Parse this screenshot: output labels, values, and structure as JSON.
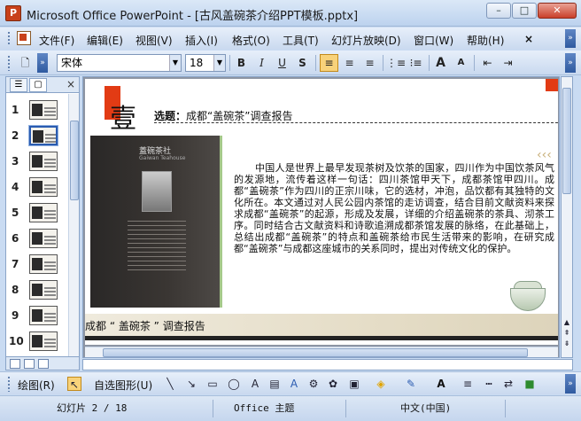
{
  "window": {
    "title": "Microsoft Office PowerPoint - [古风盖碗茶介绍PPT模板.pptx]",
    "app_icon_label": "P",
    "minimize": "–",
    "maximize": "□",
    "close": "✕"
  },
  "menu": {
    "items": [
      "文件(F)",
      "编辑(E)",
      "视图(V)",
      "插入(I)",
      "格式(O)",
      "工具(T)",
      "幻灯片放映(D)",
      "窗口(W)",
      "帮助(H)"
    ],
    "close_doc": "×"
  },
  "toolbar": {
    "new_icon": "new-doc-icon",
    "font_name": "宋体",
    "font_size": "18",
    "bold": "B",
    "italic": "I",
    "underline": "U",
    "shadow": "S",
    "align_left": "≡",
    "align_center": "≡",
    "align_right": "≡",
    "numbering": "⋮≡",
    "bullets": "⁝≡",
    "grow_font": "A",
    "shrink_font": "A",
    "decrease_indent": "⇤",
    "increase_indent": "⇥"
  },
  "outline_pane": {
    "close": "×",
    "slides": [
      {
        "number": "1"
      },
      {
        "number": "2",
        "selected": true
      },
      {
        "number": "3"
      },
      {
        "number": "4"
      },
      {
        "number": "5"
      },
      {
        "number": "6"
      },
      {
        "number": "7"
      },
      {
        "number": "8"
      },
      {
        "number": "9"
      },
      {
        "number": "10"
      }
    ]
  },
  "slide": {
    "big_char": "壹",
    "topic_label": "选题：",
    "topic_text": "成都“盖碗茶”调查报告",
    "photo_sign": "蓋碗茶社",
    "photo_sign_sub": "Gaiwan Teahouse",
    "body": "中国人是世界上最早发现茶树及饮茶的国家，四川作为中国饮茶风气的发源地，流传着这样一句话：四川茶馆甲天下，成都茶馆甲四川。成都“盖碗茶”作为四川的正宗川味，它的选材，冲泡，品饮都有其独特的文化所在。本文通过对人民公园内茶馆的走访调查，结合目前文献资料来探求成都“盖碗茶”的起源，形成及发展，详细的介绍盖碗茶的茶具、沏茶工序。同时结合古文献资料和诗歌追溯成都茶馆发展的脉络，在此基础上，总结出成都“盖碗茶”的特点和盖碗茶给市民生活带来的影响，在研究成都“盖碗茶”与成都这座城市的关系同时，提出对传统文化的保护。",
    "quote_mark": "‹‹‹",
    "footer": "成都 “ 盖碗茶 ” 调查报告"
  },
  "drawing_toolbar": {
    "draw_label": "绘图(R)",
    "autoshapes_label": "自选图形(U)"
  },
  "status": {
    "slide": "幻灯片 2 / 18",
    "theme": "Office 主题",
    "language": "中文(中国)"
  }
}
